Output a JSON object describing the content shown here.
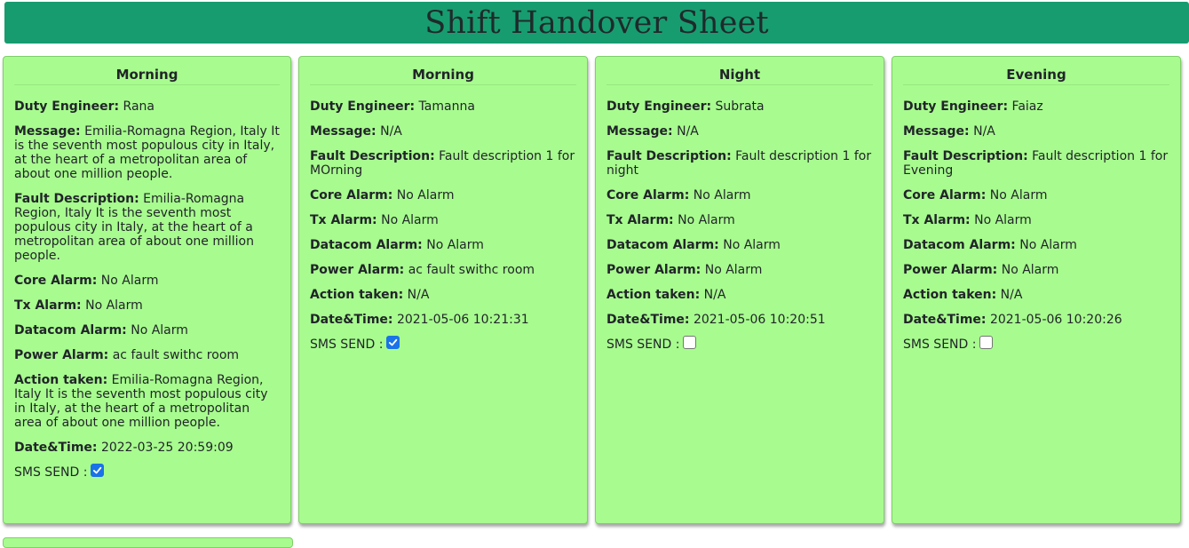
{
  "header": {
    "title": "Shift Handover Sheet",
    "color": "#179c70"
  },
  "labels": {
    "duty_engineer": "Duty Engineer:",
    "message": "Message:",
    "fault_description": "Fault Description:",
    "core_alarm": "Core Alarm:",
    "tx_alarm": "Tx Alarm:",
    "datacom_alarm": "Datacom Alarm:",
    "power_alarm": "Power Alarm:",
    "action_taken": "Action taken:",
    "date_time": "Date&Time:",
    "sms_send": "SMS SEND :"
  },
  "card_color": "#a8fc8f",
  "cards": [
    {
      "shift": "Morning",
      "duty_engineer": "Rana",
      "message": "Emilia-Romagna Region, Italy It is the seventh most populous city in Italy, at the heart of a metropolitan area of about one million people.",
      "fault_description": "Emilia-Romagna Region, Italy It is the seventh most populous city in Italy, at the heart of a metropolitan area of about one million people.",
      "core_alarm": "No Alarm",
      "tx_alarm": "No Alarm",
      "datacom_alarm": "No Alarm",
      "power_alarm": "ac fault swithc room",
      "action_taken": "Emilia-Romagna Region, Italy It is the seventh most populous city in Italy, at the heart of a metropolitan area of about one million people.",
      "date_time": "2022-03-25 20:59:09",
      "sms_send": true
    },
    {
      "shift": "Morning",
      "duty_engineer": "Tamanna",
      "message": "N/A",
      "fault_description": "Fault description 1 for MOrning",
      "core_alarm": "No Alarm",
      "tx_alarm": "No Alarm",
      "datacom_alarm": "No Alarm",
      "power_alarm": "ac fault swithc room",
      "action_taken": "N/A",
      "date_time": "2021-05-06 10:21:31",
      "sms_send": true
    },
    {
      "shift": "Night",
      "duty_engineer": "Subrata",
      "message": "N/A",
      "fault_description": "Fault description 1 for night",
      "core_alarm": "No Alarm",
      "tx_alarm": "No Alarm",
      "datacom_alarm": "No Alarm",
      "power_alarm": "No Alarm",
      "action_taken": "N/A",
      "date_time": "2021-05-06 10:20:51",
      "sms_send": false
    },
    {
      "shift": "Evening",
      "duty_engineer": "Faiaz",
      "message": "N/A",
      "fault_description": "Fault description 1 for Evening",
      "core_alarm": "No Alarm",
      "tx_alarm": "No Alarm",
      "datacom_alarm": "No Alarm",
      "power_alarm": "No Alarm",
      "action_taken": "N/A",
      "date_time": "2021-05-06 10:20:26",
      "sms_send": false
    }
  ]
}
